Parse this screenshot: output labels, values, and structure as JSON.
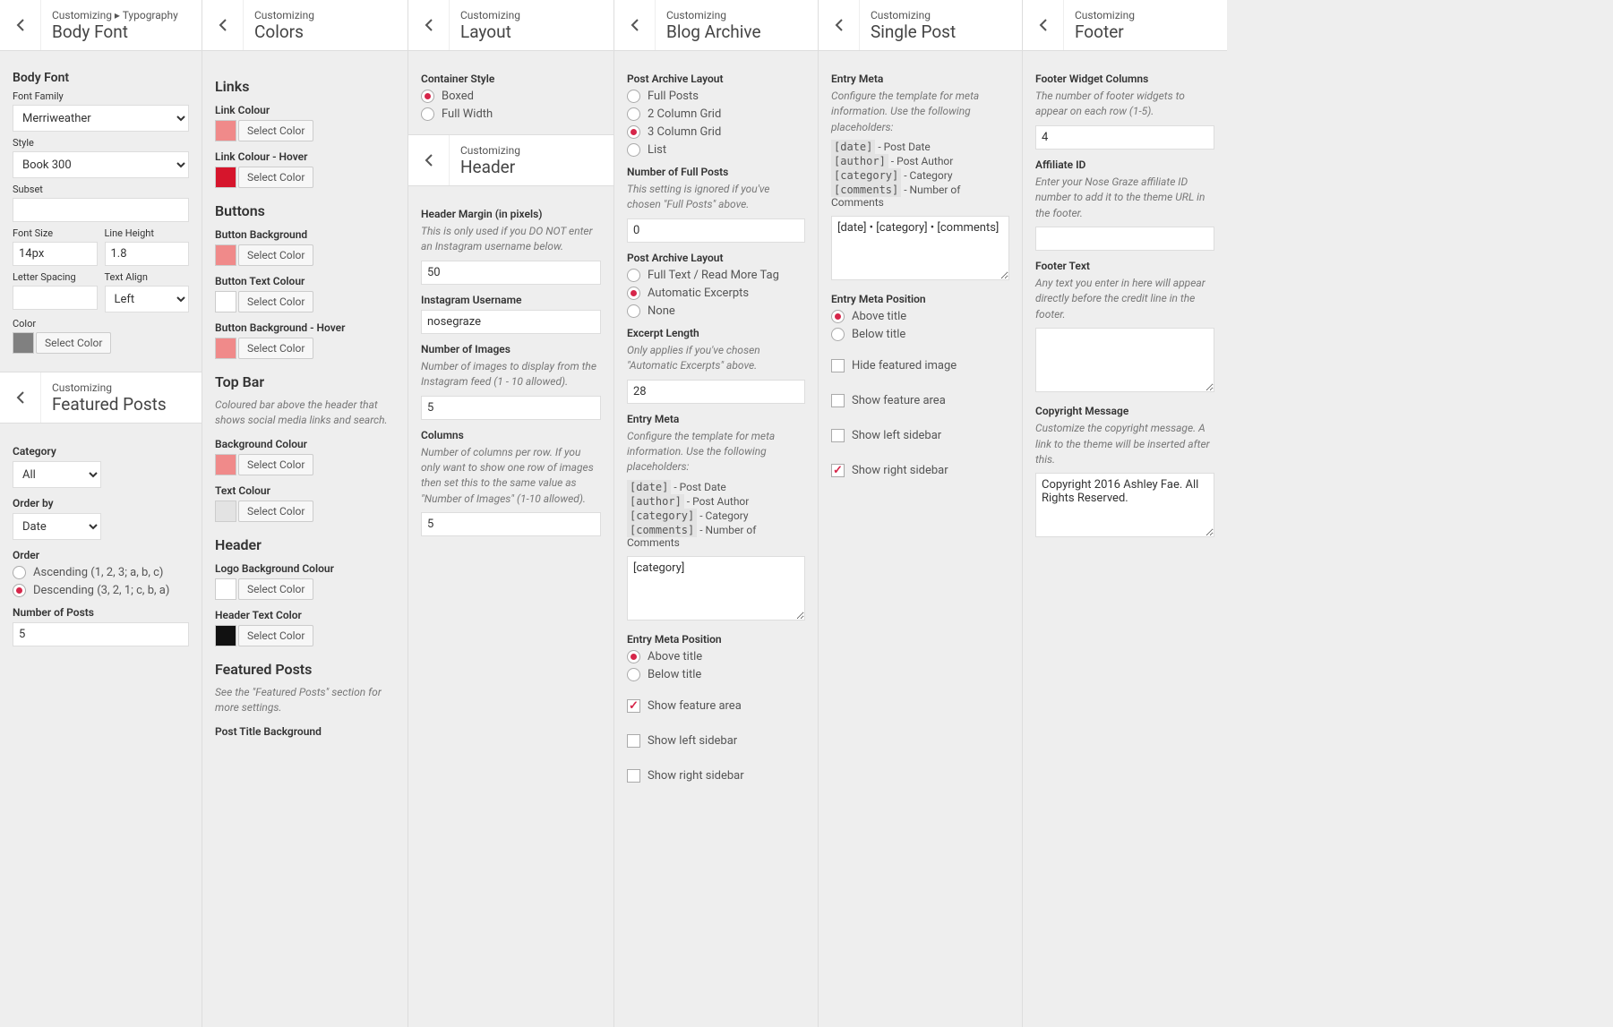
{
  "panels": {
    "body": {
      "crumb": "Customizing ▸ Typography",
      "title": "Body Font",
      "sec": "Body Font",
      "family": {
        "lbl": "Font Family",
        "val": "Merriweather"
      },
      "style": {
        "lbl": "Style",
        "val": "Book 300"
      },
      "subset": {
        "lbl": "Subset",
        "val": ""
      },
      "fontsize": {
        "lbl": "Font Size",
        "val": "14px"
      },
      "lineheight": {
        "lbl": "Line Height",
        "val": "1.8"
      },
      "letter": {
        "lbl": "Letter Spacing",
        "val": ""
      },
      "align": {
        "lbl": "Text Align",
        "val": "Left"
      },
      "color": {
        "lbl": "Color"
      }
    },
    "featured": {
      "crumb": "Customizing",
      "title": "Featured Posts",
      "category": {
        "lbl": "Category",
        "val": "All"
      },
      "orderby": {
        "lbl": "Order by",
        "val": "Date"
      },
      "order": {
        "lbl": "Order",
        "opts": [
          "Ascending (1, 2, 3; a, b, c)",
          "Descending (3, 2, 1; c, b, a)"
        ],
        "sel": 1
      },
      "num": {
        "lbl": "Number of Posts",
        "val": "5"
      }
    },
    "colors": {
      "crumb": "Customizing",
      "title": "Colors",
      "links": "Links",
      "linkColour": "Link Colour",
      "linkHover": "Link Colour - Hover",
      "buttons": "Buttons",
      "btnBg": "Button Background",
      "btnTxt": "Button Text Colour",
      "btnBgH": "Button Background - Hover",
      "topbar": "Top Bar",
      "topbarDesc": "Coloured bar above the header that shows social media links and search.",
      "bgColour": "Background Colour",
      "txtColour": "Text Colour",
      "header": "Header",
      "logoBg": "Logo Background Colour",
      "hdrTxt": "Header Text Color",
      "fposts": "Featured Posts",
      "fpostsDesc": "See the \"Featured Posts\" section for more settings.",
      "postTitleBg": "Post Title Background",
      "selectColor": "Select Color",
      "swatches": {
        "pink": "#f08a8a",
        "red": "#d6152c",
        "white": "#ffffff",
        "gray": "#e3e3e3",
        "black": "#111111",
        "mgray": "#808080"
      }
    },
    "layout": {
      "crumb": "Customizing",
      "title": "Layout",
      "container": {
        "lbl": "Container Style",
        "opts": [
          "Boxed",
          "Full Width"
        ],
        "sel": 0
      }
    },
    "headerPanel": {
      "crumb": "Customizing",
      "title": "Header",
      "margin": {
        "lbl": "Header Margin (in pixels)",
        "desc": "This is only used if you DO NOT enter an Instagram username below.",
        "val": "50"
      },
      "insta": {
        "lbl": "Instagram Username",
        "val": "nosegraze"
      },
      "numimg": {
        "lbl": "Number of Images",
        "desc": "Number of images to display from the Instagram feed (1 - 10 allowed).",
        "val": "5"
      },
      "cols": {
        "lbl": "Columns",
        "desc": "Number of columns per row. If you only want to show one row of images then set this to the same value as \"Number of Images\" (1-10 allowed).",
        "val": "5"
      }
    },
    "blog": {
      "crumb": "Customizing",
      "title": "Blog Archive",
      "layout": {
        "lbl": "Post Archive Layout",
        "opts": [
          "Full Posts",
          "2 Column Grid",
          "3 Column Grid",
          "List"
        ],
        "sel": 2
      },
      "numfull": {
        "lbl": "Number of Full Posts",
        "desc": "This setting is ignored if you've chosen \"Full Posts\" above.",
        "val": "0"
      },
      "pal2": {
        "lbl": "Post Archive Layout",
        "opts": [
          "Full Text / Read More Tag",
          "Automatic Excerpts",
          "None"
        ],
        "sel": 1
      },
      "excerpt": {
        "lbl": "Excerpt Length",
        "desc": "Only applies if you've chosen \"Automatic Excerpts\" above.",
        "val": "28"
      },
      "meta": {
        "lbl": "Entry Meta",
        "desc": "Configure the template for meta information. Use the following placeholders:",
        "val": "[category]"
      },
      "ph": {
        "date": "[date]",
        "dateD": "- Post Date",
        "author": "[author]",
        "authorD": "- Post Author",
        "cat": "[category]",
        "catD": "- Category",
        "com": "[comments]",
        "comD": "- Number of Comments"
      },
      "metapos": {
        "lbl": "Entry Meta Position",
        "opts": [
          "Above title",
          "Below title"
        ],
        "sel": 0
      },
      "cb": {
        "feature": "Show feature area",
        "left": "Show left sidebar",
        "right": "Show right sidebar"
      }
    },
    "single": {
      "crumb": "Customizing",
      "title": "Single Post",
      "meta": {
        "lbl": "Entry Meta",
        "desc": "Configure the template for meta information. Use the following placeholders:",
        "val": "[date] • [category] • [comments]"
      },
      "metapos": {
        "lbl": "Entry Meta Position",
        "opts": [
          "Above title",
          "Below title"
        ],
        "sel": 0
      },
      "cb": {
        "hide": "Hide featured image",
        "feature": "Show feature area",
        "left": "Show left sidebar",
        "right": "Show right sidebar"
      }
    },
    "footer": {
      "crumb": "Customizing",
      "title": "Footer",
      "cols": {
        "lbl": "Footer Widget Columns",
        "desc": "The number of footer widgets to appear on each row (1-5).",
        "val": "4"
      },
      "aff": {
        "lbl": "Affiliate ID",
        "desc": "Enter your Nose Graze affiliate ID number to add it to the theme URL in the footer.",
        "val": ""
      },
      "ftxt": {
        "lbl": "Footer Text",
        "desc": "Any text you enter in here will appear directly before the credit line in the footer.",
        "val": ""
      },
      "copy": {
        "lbl": "Copyright Message",
        "desc": "Customize the copyright message. A link to the theme will be inserted after this.",
        "val": "Copyright 2016 Ashley Fae. All Rights Reserved."
      }
    }
  }
}
